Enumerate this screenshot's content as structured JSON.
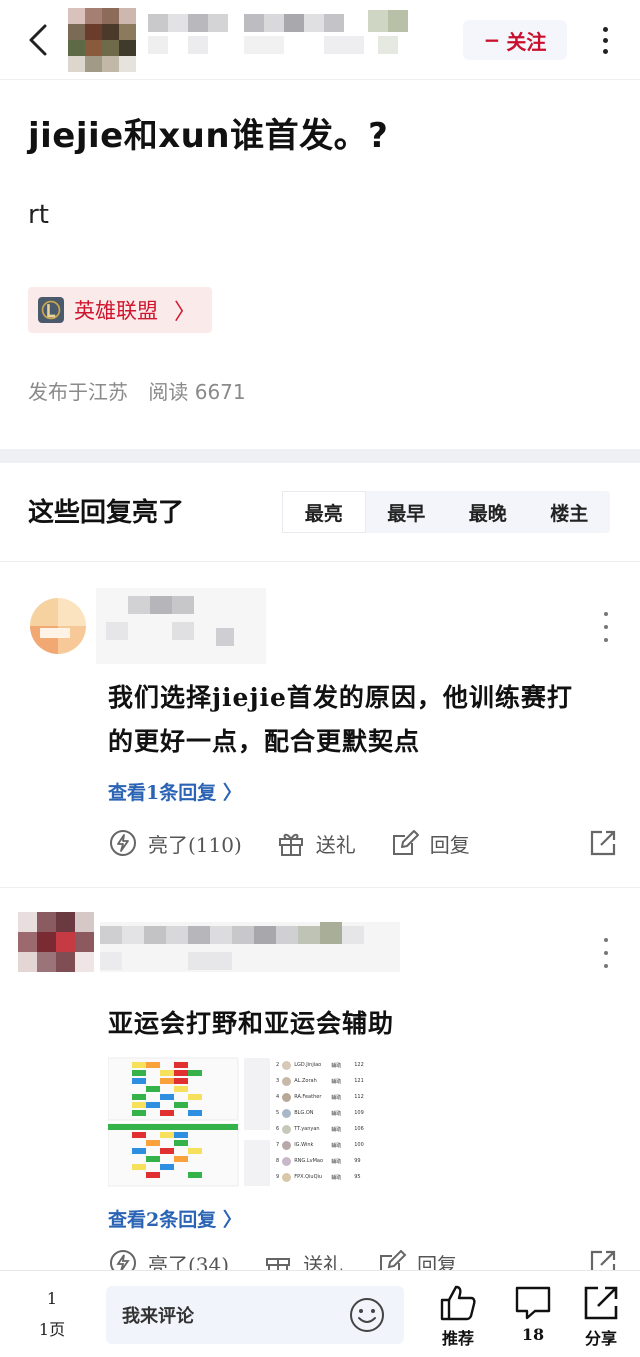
{
  "header": {
    "follow_label": "关注",
    "follow_plus": "−"
  },
  "post": {
    "title": "jiejie和xun谁首发。?",
    "body": "rt",
    "topic": "英雄联盟",
    "location": "发布于江苏",
    "reads": "阅读 6671"
  },
  "replies_section": {
    "title": "这些回复亮了",
    "tabs": [
      "最亮",
      "最早",
      "最晚",
      "楼主"
    ],
    "active_tab": "最亮"
  },
  "comments": [
    {
      "text_line1": "我们选择jiejie首发的原因，他训练赛打",
      "text_line2": "的更好一点，配合更默契点",
      "view_replies": "查看1条回复 〉",
      "like_label": "亮了(110)",
      "gift_label": "送礼",
      "reply_label": "回复"
    },
    {
      "text_line1": "亚运会打野和亚运会辅助",
      "view_replies": "查看2条回复 〉",
      "like_label": "亮了(34)",
      "gift_label": "送礼",
      "reply_label": "回复",
      "image_rows": [
        {
          "rank": "2",
          "name": "LGD.Jinjiao",
          "pos": "辅助",
          "val": "122"
        },
        {
          "rank": "3",
          "name": "AL.Zorah",
          "pos": "辅助",
          "val": "121"
        },
        {
          "rank": "4",
          "name": "RA.Feather",
          "pos": "辅助",
          "val": "112"
        },
        {
          "rank": "5",
          "name": "BLG.ON",
          "pos": "辅助",
          "val": "109"
        },
        {
          "rank": "6",
          "name": "TT.yanyan",
          "pos": "辅助",
          "val": "106"
        },
        {
          "rank": "7",
          "name": "IG.Wink",
          "pos": "辅助",
          "val": "100"
        },
        {
          "rank": "8",
          "name": "RNG.LvMao",
          "pos": "辅助",
          "val": "99"
        },
        {
          "rank": "9",
          "name": "FPX.QiuQiu",
          "pos": "辅助",
          "val": "95"
        }
      ]
    }
  ],
  "bottom_bar": {
    "page_current": "1",
    "page_total": "1页",
    "comment_placeholder": "我来评论",
    "recommend_label": "推荐",
    "comment_count": "18",
    "share_label": "分享"
  },
  "colors": {
    "accent_red": "#c8102e",
    "link_blue": "#2b64b4",
    "divider": "#eef0f4"
  },
  "icons": [
    "back-icon",
    "more-icon",
    "lol-logo-icon",
    "lightning-icon",
    "gift-icon",
    "reply-icon",
    "share-icon",
    "thumbs-up-icon",
    "comment-icon",
    "emoji-icon"
  ]
}
